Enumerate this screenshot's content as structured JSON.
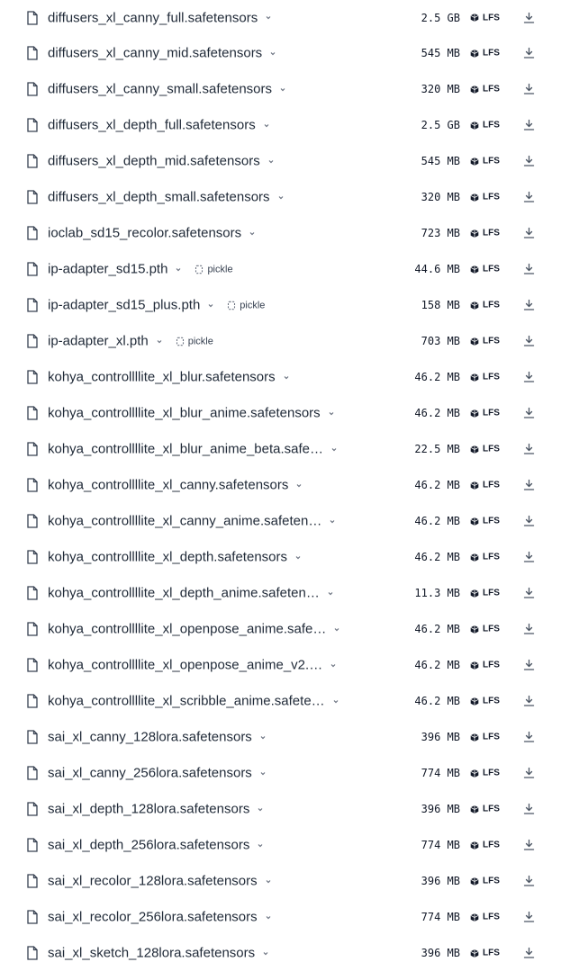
{
  "files": [
    {
      "name": "diffusers_xl_canny_full.safetensors",
      "size": "2.5 GB",
      "lfs": "LFS"
    },
    {
      "name": "diffusers_xl_canny_mid.safetensors",
      "size": "545 MB",
      "lfs": "LFS"
    },
    {
      "name": "diffusers_xl_canny_small.safetensors",
      "size": "320 MB",
      "lfs": "LFS"
    },
    {
      "name": "diffusers_xl_depth_full.safetensors",
      "size": "2.5 GB",
      "lfs": "LFS"
    },
    {
      "name": "diffusers_xl_depth_mid.safetensors",
      "size": "545 MB",
      "lfs": "LFS"
    },
    {
      "name": "diffusers_xl_depth_small.safetensors",
      "size": "320 MB",
      "lfs": "LFS"
    },
    {
      "name": "ioclab_sd15_recolor.safetensors",
      "size": "723 MB",
      "lfs": "LFS"
    },
    {
      "name": "ip-adapter_sd15.pth",
      "size": "44.6 MB",
      "lfs": "LFS",
      "pickle": "pickle"
    },
    {
      "name": "ip-adapter_sd15_plus.pth",
      "size": "158 MB",
      "lfs": "LFS",
      "pickle": "pickle"
    },
    {
      "name": "ip-adapter_xl.pth",
      "size": "703 MB",
      "lfs": "LFS",
      "pickle": "pickle"
    },
    {
      "name": "kohya_controllllite_xl_blur.safetensors",
      "size": "46.2 MB",
      "lfs": "LFS"
    },
    {
      "name": "kohya_controllllite_xl_blur_anime.safetensors",
      "size": "46.2 MB",
      "lfs": "LFS"
    },
    {
      "name": "kohya_controllllite_xl_blur_anime_beta.safe…",
      "size": "22.5 MB",
      "lfs": "LFS"
    },
    {
      "name": "kohya_controllllite_xl_canny.safetensors",
      "size": "46.2 MB",
      "lfs": "LFS"
    },
    {
      "name": "kohya_controllllite_xl_canny_anime.safeten…",
      "size": "46.2 MB",
      "lfs": "LFS"
    },
    {
      "name": "kohya_controllllite_xl_depth.safetensors",
      "size": "46.2 MB",
      "lfs": "LFS"
    },
    {
      "name": "kohya_controllllite_xl_depth_anime.safeten…",
      "size": "11.3 MB",
      "lfs": "LFS"
    },
    {
      "name": "kohya_controllllite_xl_openpose_anime.safe…",
      "size": "46.2 MB",
      "lfs": "LFS"
    },
    {
      "name": "kohya_controllllite_xl_openpose_anime_v2.…",
      "size": "46.2 MB",
      "lfs": "LFS"
    },
    {
      "name": "kohya_controllllite_xl_scribble_anime.safete…",
      "size": "46.2 MB",
      "lfs": "LFS"
    },
    {
      "name": "sai_xl_canny_128lora.safetensors",
      "size": "396 MB",
      "lfs": "LFS"
    },
    {
      "name": "sai_xl_canny_256lora.safetensors",
      "size": "774 MB",
      "lfs": "LFS"
    },
    {
      "name": "sai_xl_depth_128lora.safetensors",
      "size": "396 MB",
      "lfs": "LFS"
    },
    {
      "name": "sai_xl_depth_256lora.safetensors",
      "size": "774 MB",
      "lfs": "LFS"
    },
    {
      "name": "sai_xl_recolor_128lora.safetensors",
      "size": "396 MB",
      "lfs": "LFS"
    },
    {
      "name": "sai_xl_recolor_256lora.safetensors",
      "size": "774 MB",
      "lfs": "LFS"
    },
    {
      "name": "sai_xl_sketch_128lora.safetensors",
      "size": "396 MB",
      "lfs": "LFS"
    }
  ],
  "icons": {
    "file": "file-icon",
    "chevron": "chevron-down-icon",
    "pickle": "pickle-icon",
    "lfs": "lfs-icon",
    "download": "download-icon"
  }
}
